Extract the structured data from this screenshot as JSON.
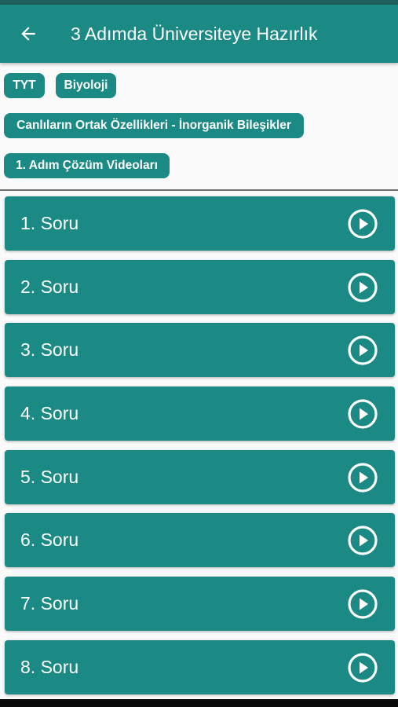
{
  "app_bar": {
    "title": "3 Adımda Üniversiteye Hazırlık",
    "back_icon": "arrow-left-icon",
    "background": "#1b8a85",
    "status_bar_color": "#1f5f5c"
  },
  "chips": {
    "exam": "TYT",
    "subject": "Biyoloji",
    "topic": "Canlıların Ortak Özellikleri - İnorganik Bileşikler",
    "step": "1. Adım Çözüm Videoları"
  },
  "questions": [
    {
      "label": "1. Soru",
      "icon": "play-circle-icon"
    },
    {
      "label": "2. Soru",
      "icon": "play-circle-icon"
    },
    {
      "label": "3. Soru",
      "icon": "play-circle-icon"
    },
    {
      "label": "4. Soru",
      "icon": "play-circle-icon"
    },
    {
      "label": "5. Soru",
      "icon": "play-circle-icon"
    },
    {
      "label": "6. Soru",
      "icon": "play-circle-icon"
    },
    {
      "label": "7. Soru",
      "icon": "play-circle-icon"
    },
    {
      "label": "8. Soru",
      "icon": "play-circle-icon"
    }
  ],
  "colors": {
    "accent": "#1b8a85",
    "background": "#fafafa",
    "text_on_accent": "#ffffff"
  }
}
